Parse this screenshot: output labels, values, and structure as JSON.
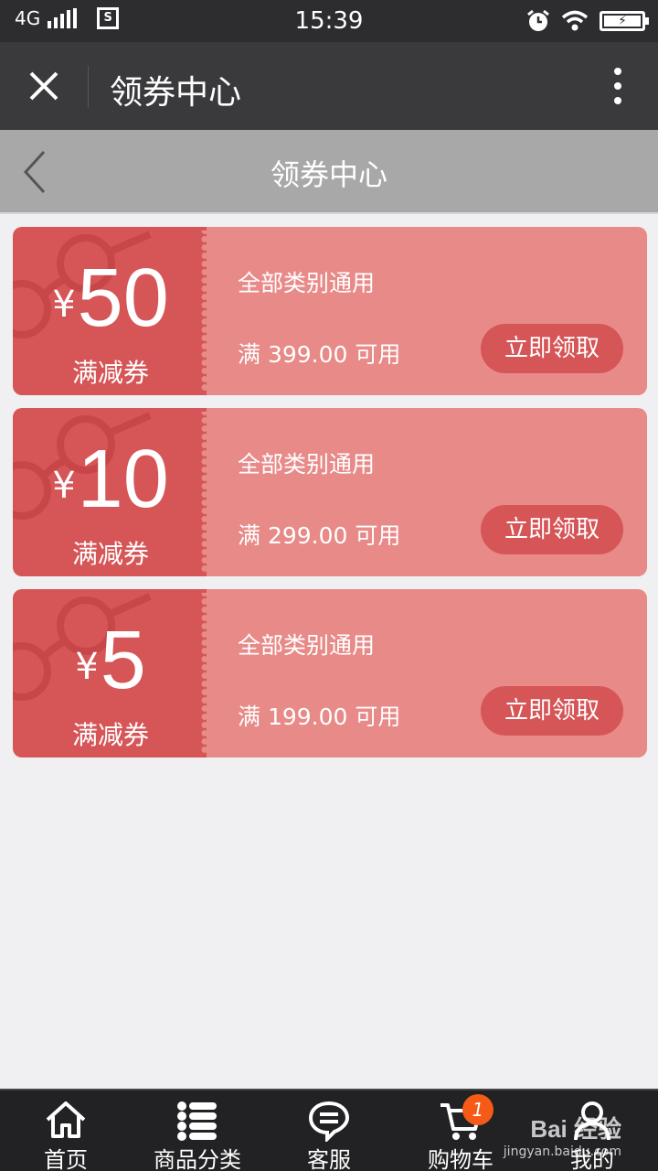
{
  "status_bar": {
    "network": "4G",
    "time": "15:39"
  },
  "top_bar": {
    "title": "领券中心"
  },
  "page_header": {
    "title": "领券中心"
  },
  "coupons": [
    {
      "currency": "¥",
      "amount": "50",
      "label": "满减券",
      "scope": "全部类别通用",
      "condition": "满 399.00 可用",
      "button": "立即领取"
    },
    {
      "currency": "¥",
      "amount": "10",
      "label": "满减券",
      "scope": "全部类别通用",
      "condition": "满 299.00 可用",
      "button": "立即领取"
    },
    {
      "currency": "¥",
      "amount": "5",
      "label": "满减券",
      "scope": "全部类别通用",
      "condition": "满 199.00 可用",
      "button": "立即领取"
    }
  ],
  "tab_bar": {
    "items": [
      {
        "label": "首页",
        "icon": "home-icon"
      },
      {
        "label": "商品分类",
        "icon": "list-icon"
      },
      {
        "label": "客服",
        "icon": "chat-icon"
      },
      {
        "label": "购物车",
        "icon": "cart-icon",
        "badge": "1"
      },
      {
        "label": "我的",
        "icon": "user-icon"
      }
    ]
  },
  "watermark": {
    "main": "Bai 经验",
    "sub": "jingyan.baidu.com"
  },
  "colors": {
    "stub": "#d65557",
    "coupon_body": "#e78a88",
    "badge": "#f55a17"
  }
}
